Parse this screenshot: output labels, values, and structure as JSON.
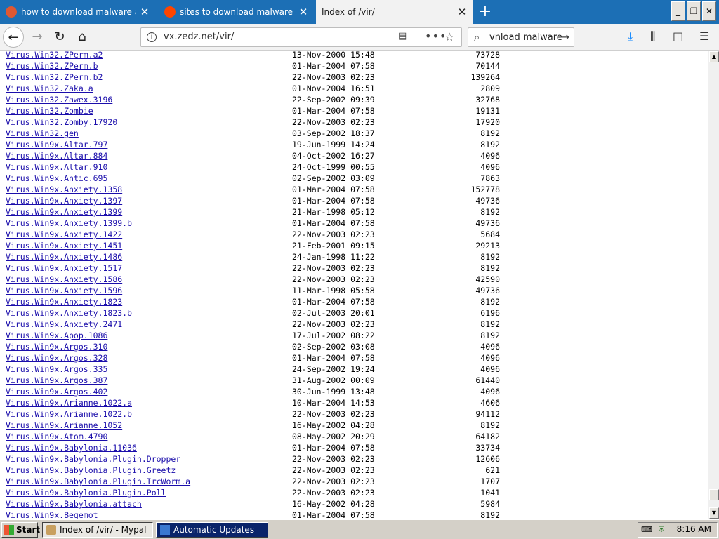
{
  "browser": {
    "tabs": [
      {
        "title": "how to download malware at Duck",
        "icon": "duckduckgo-icon",
        "color": "#de5833"
      },
      {
        "title": "sites to download malware : Malw",
        "icon": "reddit-icon",
        "color": "#ff4500"
      },
      {
        "title": "Index of /vir/",
        "icon": "",
        "color": ""
      }
    ],
    "url": "vx.zedz.net/vir/",
    "search_value": "vnload malware"
  },
  "listing": [
    {
      "name": "Virus.Win32.ZPerm.a2",
      "date": "13-Nov-2000 15:48",
      "size": "73728"
    },
    {
      "name": "Virus.Win32.ZPerm.b",
      "date": "01-Mar-2004 07:58",
      "size": "70144"
    },
    {
      "name": "Virus.Win32.ZPerm.b2",
      "date": "22-Nov-2003 02:23",
      "size": "139264"
    },
    {
      "name": "Virus.Win32.Zaka.a",
      "date": "01-Nov-2004 16:51",
      "size": "2809"
    },
    {
      "name": "Virus.Win32.Zawex.3196",
      "date": "22-Sep-2002 09:39",
      "size": "32768"
    },
    {
      "name": "Virus.Win32.Zombie",
      "date": "01-Mar-2004 07:58",
      "size": "19131"
    },
    {
      "name": "Virus.Win32.Zomby.17920",
      "date": "22-Nov-2003 02:23",
      "size": "17920"
    },
    {
      "name": "Virus.Win32.gen",
      "date": "03-Sep-2002 18:37",
      "size": "8192"
    },
    {
      "name": "Virus.Win9x.Altar.797",
      "date": "19-Jun-1999 14:24",
      "size": "8192"
    },
    {
      "name": "Virus.Win9x.Altar.884",
      "date": "04-Oct-2002 16:27",
      "size": "4096"
    },
    {
      "name": "Virus.Win9x.Altar.910",
      "date": "24-Oct-1999 00:55",
      "size": "4096"
    },
    {
      "name": "Virus.Win9x.Antic.695",
      "date": "02-Sep-2002 03:09",
      "size": "7863"
    },
    {
      "name": "Virus.Win9x.Anxiety.1358",
      "date": "01-Mar-2004 07:58",
      "size": "152778"
    },
    {
      "name": "Virus.Win9x.Anxiety.1397",
      "date": "01-Mar-2004 07:58",
      "size": "49736"
    },
    {
      "name": "Virus.Win9x.Anxiety.1399",
      "date": "21-Mar-1998 05:12",
      "size": "8192"
    },
    {
      "name": "Virus.Win9x.Anxiety.1399.b",
      "date": "01-Mar-2004 07:58",
      "size": "49736"
    },
    {
      "name": "Virus.Win9x.Anxiety.1422",
      "date": "22-Nov-2003 02:23",
      "size": "5684"
    },
    {
      "name": "Virus.Win9x.Anxiety.1451",
      "date": "21-Feb-2001 09:15",
      "size": "29213"
    },
    {
      "name": "Virus.Win9x.Anxiety.1486",
      "date": "24-Jan-1998 11:22",
      "size": "8192"
    },
    {
      "name": "Virus.Win9x.Anxiety.1517",
      "date": "22-Nov-2003 02:23",
      "size": "8192"
    },
    {
      "name": "Virus.Win9x.Anxiety.1586",
      "date": "22-Nov-2003 02:23",
      "size": "42590"
    },
    {
      "name": "Virus.Win9x.Anxiety.1596",
      "date": "11-Mar-1998 05:58",
      "size": "49736"
    },
    {
      "name": "Virus.Win9x.Anxiety.1823",
      "date": "01-Mar-2004 07:58",
      "size": "8192"
    },
    {
      "name": "Virus.Win9x.Anxiety.1823.b",
      "date": "02-Jul-2003 20:01",
      "size": "6196"
    },
    {
      "name": "Virus.Win9x.Anxiety.2471",
      "date": "22-Nov-2003 02:23",
      "size": "8192"
    },
    {
      "name": "Virus.Win9x.Apop.1086",
      "date": "17-Jul-2002 08:22",
      "size": "8192"
    },
    {
      "name": "Virus.Win9x.Argos.310",
      "date": "02-Sep-2002 03:08",
      "size": "4096"
    },
    {
      "name": "Virus.Win9x.Argos.328",
      "date": "01-Mar-2004 07:58",
      "size": "4096"
    },
    {
      "name": "Virus.Win9x.Argos.335",
      "date": "24-Sep-2002 19:24",
      "size": "4096"
    },
    {
      "name": "Virus.Win9x.Argos.387",
      "date": "31-Aug-2002 00:09",
      "size": "61440"
    },
    {
      "name": "Virus.Win9x.Argos.402",
      "date": "30-Jun-1999 13:48",
      "size": "4096"
    },
    {
      "name": "Virus.Win9x.Arianne.1022.a",
      "date": "10-Mar-2004 14:53",
      "size": "4606"
    },
    {
      "name": "Virus.Win9x.Arianne.1022.b",
      "date": "22-Nov-2003 02:23",
      "size": "94112"
    },
    {
      "name": "Virus.Win9x.Arianne.1052",
      "date": "16-May-2002 04:28",
      "size": "8192"
    },
    {
      "name": "Virus.Win9x.Atom.4790",
      "date": "08-May-2002 20:29",
      "size": "64182"
    },
    {
      "name": "Virus.Win9x.Babylonia.11036",
      "date": "01-Mar-2004 07:58",
      "size": "33734"
    },
    {
      "name": "Virus.Win9x.Babylonia.Plugin.Dropper",
      "date": "22-Nov-2003 02:23",
      "size": "12606"
    },
    {
      "name": "Virus.Win9x.Babylonia.Plugin.Greetz",
      "date": "22-Nov-2003 02:23",
      "size": "621"
    },
    {
      "name": "Virus.Win9x.Babylonia.Plugin.IrcWorm.a",
      "date": "22-Nov-2003 02:23",
      "size": "1707"
    },
    {
      "name": "Virus.Win9x.Babylonia.Plugin.Poll",
      "date": "22-Nov-2003 02:23",
      "size": "1041"
    },
    {
      "name": "Virus.Win9x.Babylonia.attach",
      "date": "16-May-2002 04:28",
      "size": "5984"
    },
    {
      "name": "Virus.Win9x.Begemot",
      "date": "01-Mar-2004 07:58",
      "size": "8192"
    }
  ],
  "taskbar": {
    "start_label": "Start",
    "items": [
      {
        "label": "Index of /vir/ - Mypal"
      },
      {
        "label": "Automatic Updates"
      }
    ],
    "clock": "8:16 AM"
  }
}
